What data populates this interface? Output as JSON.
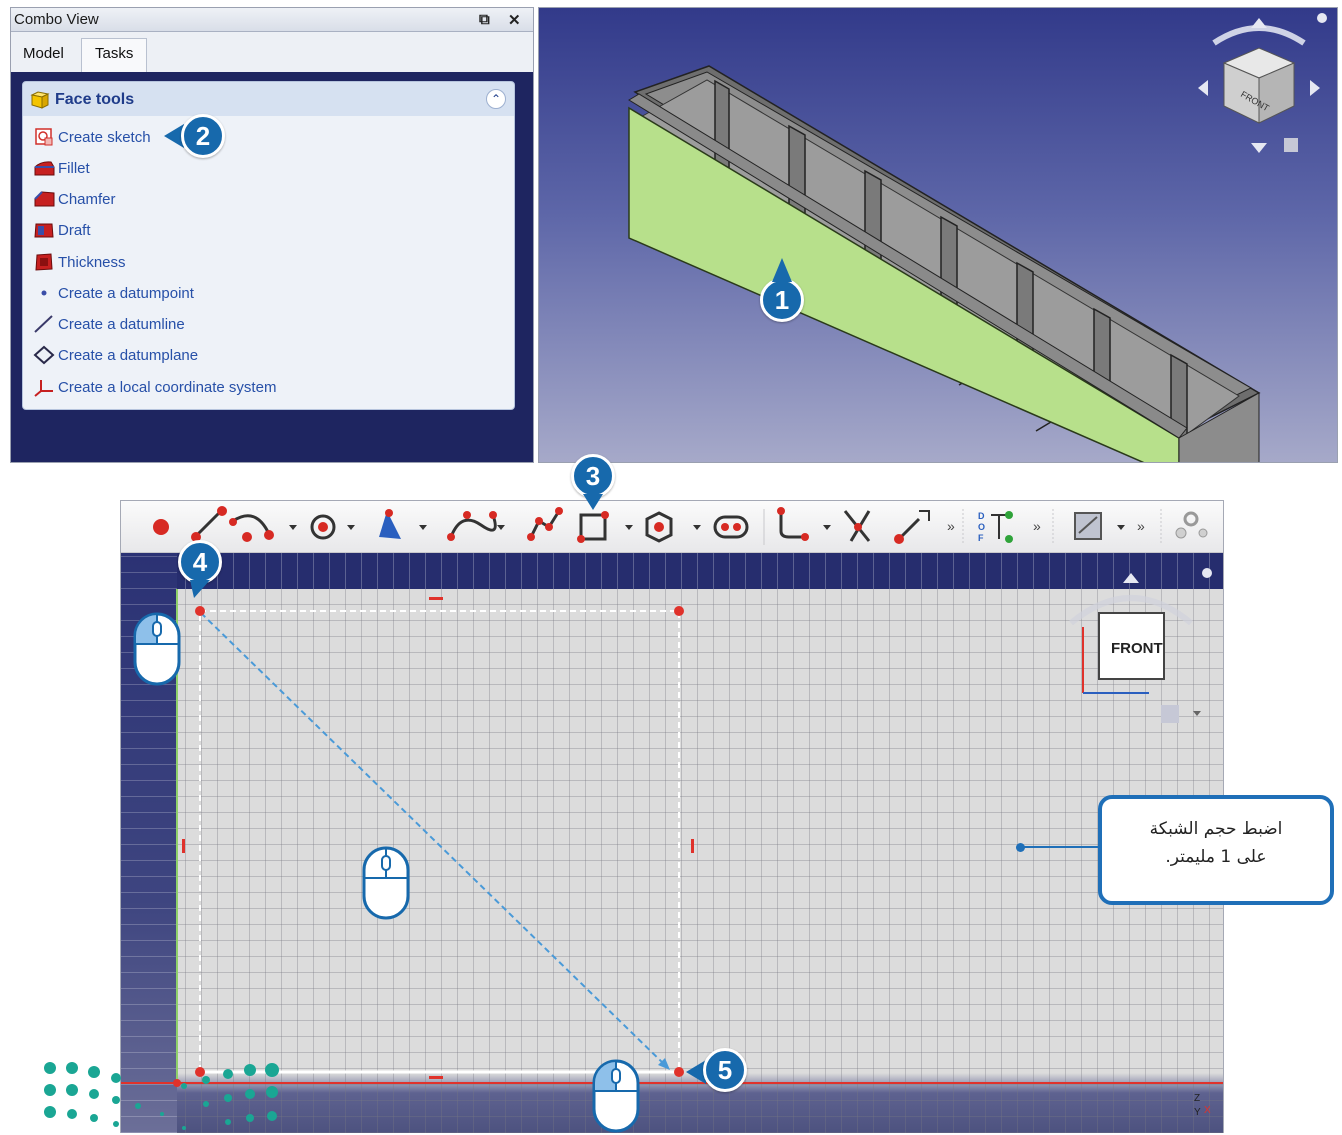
{
  "combo_view": {
    "title": "Combo View",
    "float_icon": "⧉",
    "close_icon": "✕",
    "tabs": [
      {
        "label": "Model"
      },
      {
        "label": "Tasks"
      }
    ],
    "panel": {
      "title": "Face tools",
      "items": [
        {
          "label": "Create sketch"
        },
        {
          "label": "Fillet"
        },
        {
          "label": "Chamfer"
        },
        {
          "label": "Draft"
        },
        {
          "label": "Thickness"
        },
        {
          "label": "Create a datumpoint"
        },
        {
          "label": "Create a datumline"
        },
        {
          "label": "Create a datumplane"
        },
        {
          "label": "Create a local coordinate system"
        }
      ]
    }
  },
  "sketcher": {
    "navcube_label": "FRONT",
    "axis_labels": {
      "z": "Z",
      "y": "Y",
      "x": "X"
    },
    "dof_label": "DOF"
  },
  "badges": {
    "b1": "1",
    "b2": "2",
    "b3": "3",
    "b4": "4",
    "b5": "5"
  },
  "callout": {
    "line1": "اضبط حجم الشبكة",
    "line2": "على 1 مليمتر."
  },
  "colors": {
    "accent": "#1769ac",
    "face_green": "#b7e08b",
    "sketch_point": "#e0322b",
    "guide_line": "#4a9ad8"
  }
}
